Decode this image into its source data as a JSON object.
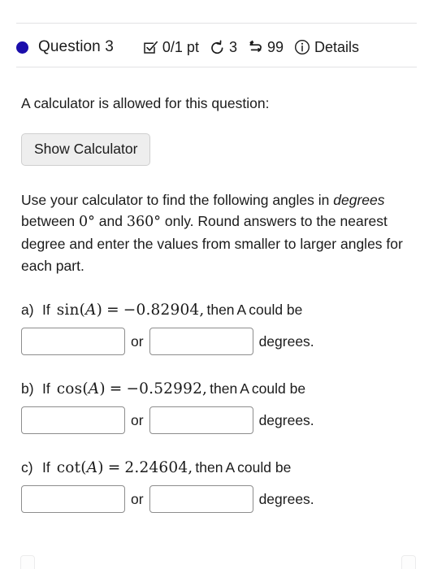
{
  "header": {
    "status_dot_color": "#1a0dab",
    "question_label": "Question 3",
    "score": "0/1 pt",
    "attempts": "3",
    "versions": "99",
    "details_label": "Details",
    "icons": {
      "score": "checkbox-checked-icon",
      "attempts": "undo-rotate-icon",
      "versions": "swap-arrows-icon",
      "details": "info-circle-icon"
    }
  },
  "body": {
    "calculator_note": "A calculator is allowed for this question:",
    "calculator_button": "Show Calculator",
    "instructions": {
      "seg1": "Use your calculator to find the following angles in ",
      "emphasis": "degrees",
      "seg2": " between ",
      "min_angle": "0°",
      "seg3": " and ",
      "max_angle": "360°",
      "seg4": " only. Round answers to the nearest degree and enter the values from smaller to larger angles for each part."
    }
  },
  "parts": [
    {
      "label": "a)",
      "if_text": "If",
      "fn": "sin",
      "open": "(",
      "var": "A",
      "close": ")",
      "eq": "=",
      "value": "−0.82904",
      "comma": ",",
      "then_text": "then",
      "then_var": "A",
      "could_be": "could be",
      "input1_value": "",
      "input2_value": "",
      "or_label": "or",
      "unit_label": "degrees."
    },
    {
      "label": "b)",
      "if_text": "If",
      "fn": "cos",
      "open": "(",
      "var": "A",
      "close": ")",
      "eq": "=",
      "value": "−0.52992",
      "comma": ",",
      "then_text": "then",
      "then_var": "A",
      "could_be": "could be",
      "input1_value": "",
      "input2_value": "",
      "or_label": "or",
      "unit_label": "degrees."
    },
    {
      "label": "c)",
      "if_text": "If",
      "fn": "cot",
      "open": "(",
      "var": "A",
      "close": ")",
      "eq": "=",
      "value": "2.24604",
      "comma": ",",
      "then_text": "then",
      "then_var": "A",
      "could_be": "could be",
      "input1_value": "",
      "input2_value": "",
      "or_label": "or",
      "unit_label": "degrees."
    }
  ],
  "colors": {
    "divider": "#e3e3e4",
    "text": "#1b1b1b",
    "button_bg": "#eeeeee",
    "input_border": "#8d8d8d"
  }
}
